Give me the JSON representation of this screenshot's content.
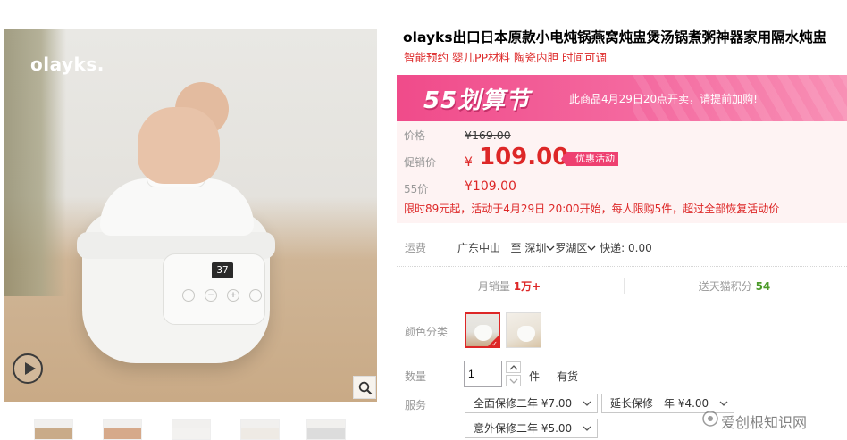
{
  "gallery": {
    "brand_logo": "olayks.",
    "display_reading": "37",
    "panel_buttons": [
      "",
      "−",
      "+",
      ""
    ],
    "thumbnail_count": 5
  },
  "product": {
    "title": "olayks出口日本原款小电炖锅燕窝炖盅煲汤锅煮粥神器家用隔水炖盅",
    "subtitle": "智能预约 婴儿PP材料 陶瓷内胆 时间可调"
  },
  "promo": {
    "logo": "55划算节",
    "notice": "此商品4月29日20点开卖，请提前加购!",
    "colors": {
      "banner": "#f04b8a",
      "accent": "#dd2727"
    }
  },
  "pricing": {
    "list_label": "价格",
    "list_price": "¥169.00",
    "sale_label": "促销价",
    "currency": "¥",
    "sale_price": "109.00",
    "badge": "优惠活动",
    "event_label": "55价",
    "event_price": "¥109.00",
    "limit_note": "限时89元起，活动于4月29日 20:00开始，每人限购5件，超过全部恢复活动价"
  },
  "shipping": {
    "label": "运费",
    "from": "广东中山",
    "to_prefix": "至",
    "to_city": "深圳",
    "to_district": "罗湖区",
    "express": "快递: 0.00"
  },
  "stats": {
    "sales_label": "月销量",
    "sales_value": "1万+",
    "points_label": "送天猫积分",
    "points_value": "54"
  },
  "options": {
    "color_label": "颜色分类",
    "qty_label": "数量",
    "qty_value": "1",
    "qty_unit": "件",
    "stock": "有货",
    "service_label": "服务",
    "services": [
      "全面保修二年  ¥7.00",
      "延长保修一年  ¥4.00",
      "意外保修二年  ¥5.00"
    ]
  },
  "watermark": "爱创根知识网",
  "icons": [
    "play-icon",
    "zoom-icon",
    "chevron-down-icon",
    "arrow-up-icon",
    "arrow-down-icon",
    "check-icon"
  ]
}
